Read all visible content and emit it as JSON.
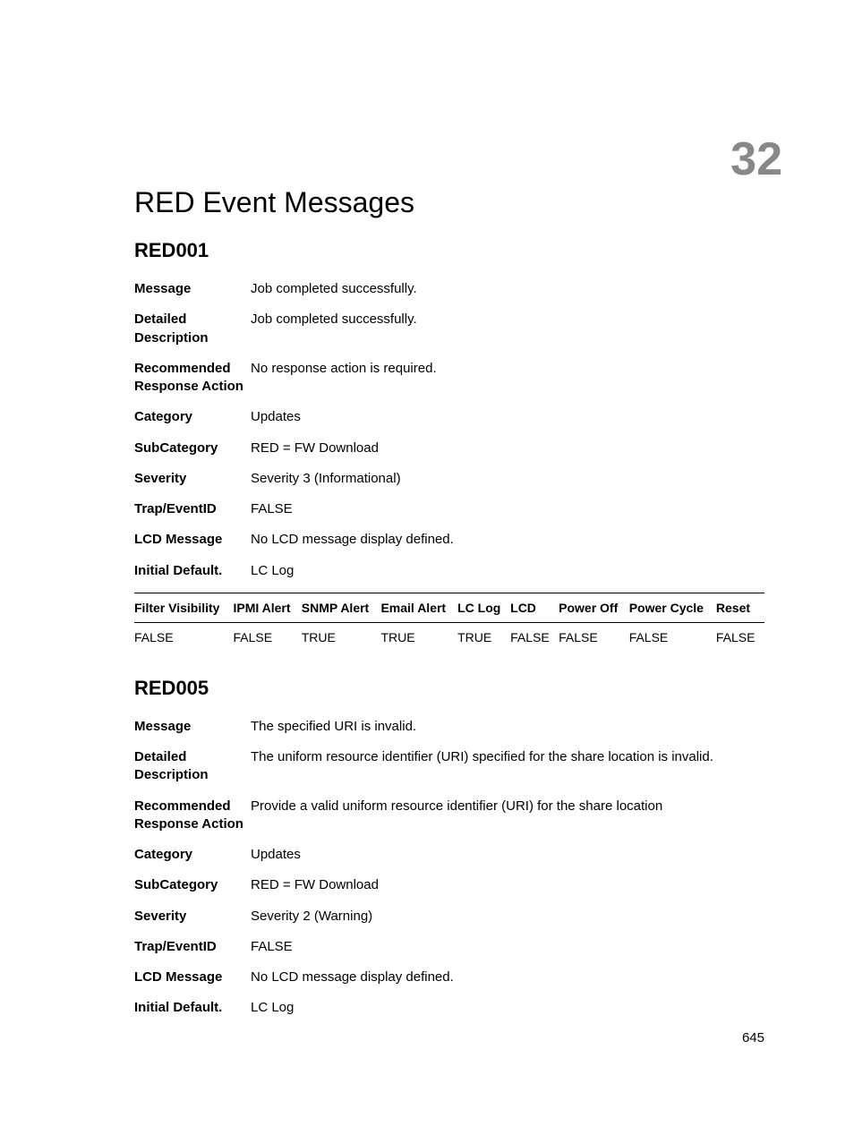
{
  "chapter_number": "32",
  "page_title": "RED Event Messages",
  "page_number": "645",
  "field_labels": {
    "message": "Message",
    "detailed": "Detailed Description",
    "recommended": "Recommended Response Action",
    "category": "Category",
    "subcategory": "SubCategory",
    "severity": "Severity",
    "trap": "Trap/EventID",
    "lcd": "LCD Message",
    "initial": "Initial Default."
  },
  "table_headers": [
    "Filter Visibility",
    "IPMI Alert",
    "SNMP Alert",
    "Email Alert",
    "LC Log",
    "LCD",
    "Power Off",
    "Power Cycle",
    "Reset"
  ],
  "sections": [
    {
      "id": "RED001",
      "message": "Job completed successfully.",
      "detailed": "Job completed successfully.",
      "recommended": "No response action is required.",
      "category": "Updates",
      "subcategory": "RED = FW Download",
      "severity": "Severity 3 (Informational)",
      "trap": "FALSE",
      "lcd": "No LCD message display defined.",
      "initial": "LC Log",
      "table_row": [
        "FALSE",
        "FALSE",
        "TRUE",
        "TRUE",
        "TRUE",
        "FALSE",
        "FALSE",
        "FALSE",
        "FALSE"
      ]
    },
    {
      "id": "RED005",
      "message": "The specified URI is invalid.",
      "detailed": "The uniform resource identifier (URI) specified for the share location is invalid.",
      "recommended": "Provide a valid uniform resource identifier (URI) for the share location",
      "category": "Updates",
      "subcategory": "RED = FW Download",
      "severity": "Severity 2 (Warning)",
      "trap": "FALSE",
      "lcd": "No LCD message display defined.",
      "initial": "LC Log"
    }
  ]
}
